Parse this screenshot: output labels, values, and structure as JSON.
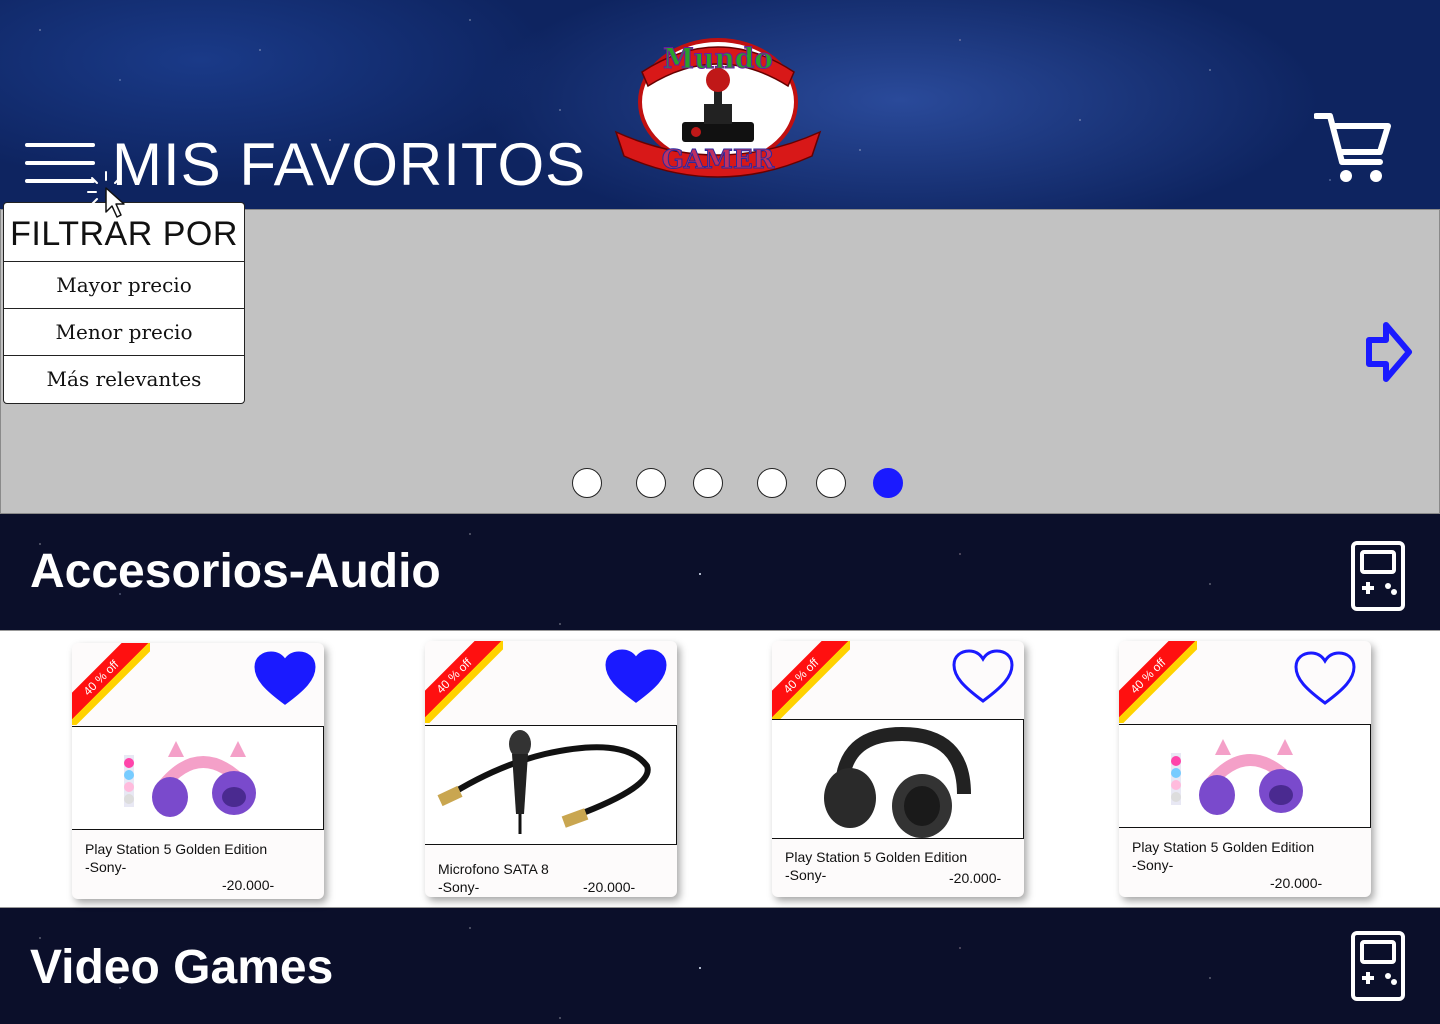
{
  "header": {
    "title": "MIS FAVORITOS",
    "logo_text_top": "Mundo",
    "logo_text_bottom": "GAMER"
  },
  "filter_menu": {
    "title": "FILTRAR POR",
    "options": [
      "Mayor precio",
      "Menor precio",
      "Más relevantes"
    ]
  },
  "carousel": {
    "dot_count": 6,
    "active_dot": 6
  },
  "sections": [
    {
      "title": "Accesorios-Audio"
    },
    {
      "title": "Video Games"
    }
  ],
  "products": [
    {
      "badge": "40 % off",
      "name": "Play Station 5 Golden Edition",
      "brand": "-Sony-",
      "price": "-20.000-",
      "favorite": true
    },
    {
      "badge": "40 % off",
      "name": "Microfono SATA 8",
      "brand": "-Sony-",
      "price": "-20.000-",
      "favorite": true
    },
    {
      "badge": "40 % off",
      "name": "Play Station 5 Golden Edition",
      "brand": "-Sony-",
      "price": "-20.000-",
      "favorite": false
    },
    {
      "badge": "40 % off",
      "name": "Play Station 5 Golden Edition",
      "brand": "-Sony-",
      "price": "-20.000-",
      "favorite": false
    }
  ],
  "colors": {
    "accent": "#1a1aff",
    "carousel_bg": "#c2c2c2",
    "badge_red": "#ff1010",
    "badge_yellow": "#ffd200"
  }
}
